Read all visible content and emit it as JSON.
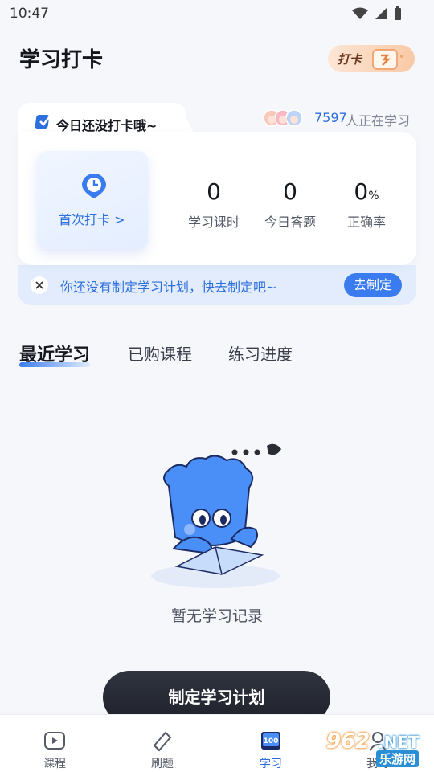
{
  "status_bar": {
    "time": "10:47"
  },
  "header": {
    "title": "学习打卡",
    "badge_label": "打卡"
  },
  "checkin_card": {
    "todo_text": "今日还没打卡哦~",
    "learners_count": "7597",
    "learners_label": "人正在学习",
    "first_checkin_label": "首次打卡 >",
    "stats": [
      {
        "value": "0",
        "unit": "",
        "label": "学习课时"
      },
      {
        "value": "0",
        "unit": "",
        "label": "今日答题"
      },
      {
        "value": "0",
        "unit": "%",
        "label": "正确率"
      }
    ],
    "plan_prompt": "你还没有制定学习计划，快去制定吧~",
    "plan_button": "去制定"
  },
  "tabs": [
    {
      "label": "最近学习",
      "active": true
    },
    {
      "label": "已购课程",
      "active": false
    },
    {
      "label": "练习进度",
      "active": false
    }
  ],
  "empty_state": {
    "text": "暂无学习记录"
  },
  "make_plan_button": "制定学习计划",
  "bottom_nav": [
    {
      "label": "课程",
      "icon": "play-icon",
      "active": false
    },
    {
      "label": "刷题",
      "icon": "edit-icon",
      "active": false
    },
    {
      "label": "学习",
      "icon": "book-100-icon",
      "active": true
    },
    {
      "label": "我的",
      "icon": "profile-icon",
      "active": false
    }
  ],
  "watermark": {
    "num": "962",
    "net": ".NET",
    "cn": "乐游网"
  },
  "colors": {
    "accent": "#3a7cf0",
    "dark_button": "#1e212a",
    "background": "#f6f7fb"
  }
}
